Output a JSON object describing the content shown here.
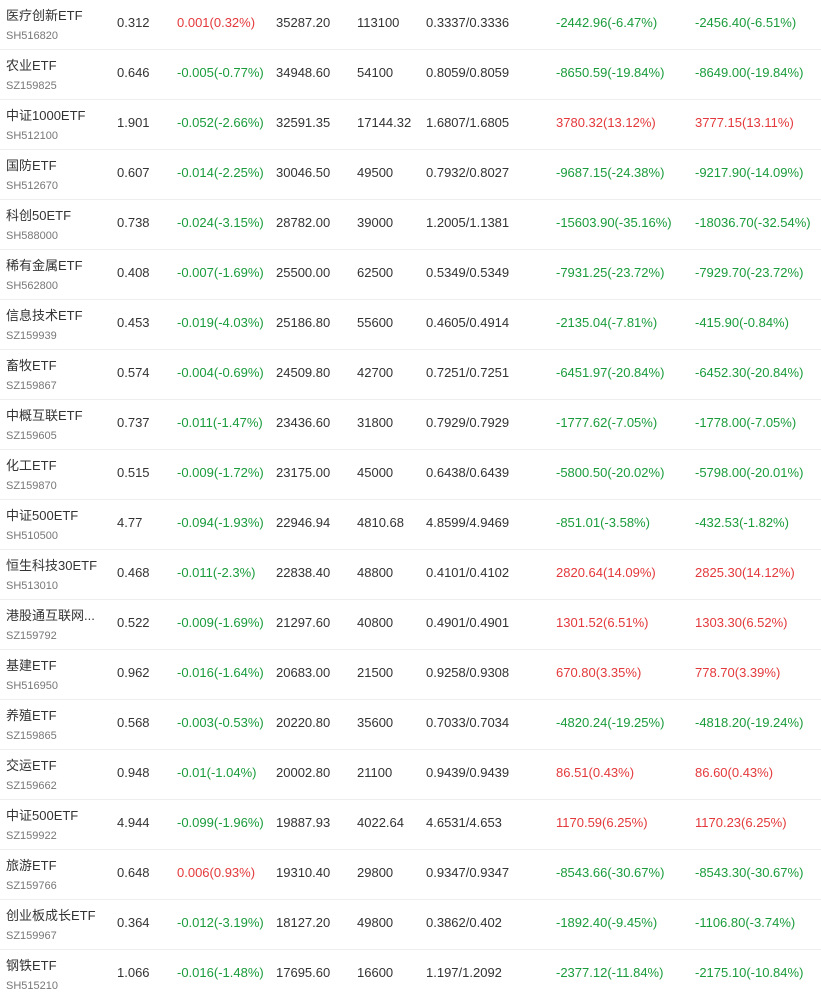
{
  "colors": {
    "up": "#e4393c",
    "down": "#1a9c3c",
    "text": "#333333",
    "subtext": "#777777",
    "divider": "#eeeeee"
  },
  "rows": [
    {
      "name": "医疗创新ETF",
      "code": "SH516820",
      "price": "0.312",
      "change": "0.001(0.32%)",
      "change_dir": "up",
      "amount": "35287.20",
      "share": "113100",
      "nav": "0.3337/0.3336",
      "pnl1": "-2442.96(-6.47%)",
      "pnl1_dir": "down",
      "pnl2": "-2456.40(-6.51%)",
      "pnl2_dir": "down"
    },
    {
      "name": "农业ETF",
      "code": "SZ159825",
      "price": "0.646",
      "change": "-0.005(-0.77%)",
      "change_dir": "down",
      "amount": "34948.60",
      "share": "54100",
      "nav": "0.8059/0.8059",
      "pnl1": "-8650.59(-19.84%)",
      "pnl1_dir": "down",
      "pnl2": "-8649.00(-19.84%)",
      "pnl2_dir": "down"
    },
    {
      "name": "中证1000ETF",
      "code": "SH512100",
      "price": "1.901",
      "change": "-0.052(-2.66%)",
      "change_dir": "down",
      "amount": "32591.35",
      "share": "17144.32",
      "nav": "1.6807/1.6805",
      "pnl1": "3780.32(13.12%)",
      "pnl1_dir": "up",
      "pnl2": "3777.15(13.11%)",
      "pnl2_dir": "up"
    },
    {
      "name": "国防ETF",
      "code": "SH512670",
      "price": "0.607",
      "change": "-0.014(-2.25%)",
      "change_dir": "down",
      "amount": "30046.50",
      "share": "49500",
      "nav": "0.7932/0.8027",
      "pnl1": "-9687.15(-24.38%)",
      "pnl1_dir": "down",
      "pnl2": "-9217.90(-14.09%)",
      "pnl2_dir": "down"
    },
    {
      "name": "科创50ETF",
      "code": "SH588000",
      "price": "0.738",
      "change": "-0.024(-3.15%)",
      "change_dir": "down",
      "amount": "28782.00",
      "share": "39000",
      "nav": "1.2005/1.1381",
      "pnl1": "-15603.90(-35.16%)",
      "pnl1_dir": "down",
      "pnl2": "-18036.70(-32.54%)",
      "pnl2_dir": "down"
    },
    {
      "name": "稀有金属ETF",
      "code": "SH562800",
      "price": "0.408",
      "change": "-0.007(-1.69%)",
      "change_dir": "down",
      "amount": "25500.00",
      "share": "62500",
      "nav": "0.5349/0.5349",
      "pnl1": "-7931.25(-23.72%)",
      "pnl1_dir": "down",
      "pnl2": "-7929.70(-23.72%)",
      "pnl2_dir": "down"
    },
    {
      "name": "信息技术ETF",
      "code": "SZ159939",
      "price": "0.453",
      "change": "-0.019(-4.03%)",
      "change_dir": "down",
      "amount": "25186.80",
      "share": "55600",
      "nav": "0.4605/0.4914",
      "pnl1": "-2135.04(-7.81%)",
      "pnl1_dir": "down",
      "pnl2": "-415.90(-0.84%)",
      "pnl2_dir": "down"
    },
    {
      "name": "畜牧ETF",
      "code": "SZ159867",
      "price": "0.574",
      "change": "-0.004(-0.69%)",
      "change_dir": "down",
      "amount": "24509.80",
      "share": "42700",
      "nav": "0.7251/0.7251",
      "pnl1": "-6451.97(-20.84%)",
      "pnl1_dir": "down",
      "pnl2": "-6452.30(-20.84%)",
      "pnl2_dir": "down"
    },
    {
      "name": "中概互联ETF",
      "code": "SZ159605",
      "price": "0.737",
      "change": "-0.011(-1.47%)",
      "change_dir": "down",
      "amount": "23436.60",
      "share": "31800",
      "nav": "0.7929/0.7929",
      "pnl1": "-1777.62(-7.05%)",
      "pnl1_dir": "down",
      "pnl2": "-1778.00(-7.05%)",
      "pnl2_dir": "down"
    },
    {
      "name": "化工ETF",
      "code": "SZ159870",
      "price": "0.515",
      "change": "-0.009(-1.72%)",
      "change_dir": "down",
      "amount": "23175.00",
      "share": "45000",
      "nav": "0.6438/0.6439",
      "pnl1": "-5800.50(-20.02%)",
      "pnl1_dir": "down",
      "pnl2": "-5798.00(-20.01%)",
      "pnl2_dir": "down"
    },
    {
      "name": "中证500ETF",
      "code": "SH510500",
      "price": "4.77",
      "change": "-0.094(-1.93%)",
      "change_dir": "down",
      "amount": "22946.94",
      "share": "4810.68",
      "nav": "4.8599/4.9469",
      "pnl1": "-851.01(-3.58%)",
      "pnl1_dir": "down",
      "pnl2": "-432.53(-1.82%)",
      "pnl2_dir": "down"
    },
    {
      "name": "恒生科技30ETF",
      "code": "SH513010",
      "price": "0.468",
      "change": "-0.011(-2.3%)",
      "change_dir": "down",
      "amount": "22838.40",
      "share": "48800",
      "nav": "0.4101/0.4102",
      "pnl1": "2820.64(14.09%)",
      "pnl1_dir": "up",
      "pnl2": "2825.30(14.12%)",
      "pnl2_dir": "up"
    },
    {
      "name": "港股通互联网...",
      "code": "SZ159792",
      "price": "0.522",
      "change": "-0.009(-1.69%)",
      "change_dir": "down",
      "amount": "21297.60",
      "share": "40800",
      "nav": "0.4901/0.4901",
      "pnl1": "1301.52(6.51%)",
      "pnl1_dir": "up",
      "pnl2": "1303.30(6.52%)",
      "pnl2_dir": "up"
    },
    {
      "name": "基建ETF",
      "code": "SH516950",
      "price": "0.962",
      "change": "-0.016(-1.64%)",
      "change_dir": "down",
      "amount": "20683.00",
      "share": "21500",
      "nav": "0.9258/0.9308",
      "pnl1": "670.80(3.35%)",
      "pnl1_dir": "up",
      "pnl2": "778.70(3.39%)",
      "pnl2_dir": "up"
    },
    {
      "name": "养殖ETF",
      "code": "SZ159865",
      "price": "0.568",
      "change": "-0.003(-0.53%)",
      "change_dir": "down",
      "amount": "20220.80",
      "share": "35600",
      "nav": "0.7033/0.7034",
      "pnl1": "-4820.24(-19.25%)",
      "pnl1_dir": "down",
      "pnl2": "-4818.20(-19.24%)",
      "pnl2_dir": "down"
    },
    {
      "name": "交运ETF",
      "code": "SZ159662",
      "price": "0.948",
      "change": "-0.01(-1.04%)",
      "change_dir": "down",
      "amount": "20002.80",
      "share": "21100",
      "nav": "0.9439/0.9439",
      "pnl1": "86.51(0.43%)",
      "pnl1_dir": "up",
      "pnl2": "86.60(0.43%)",
      "pnl2_dir": "up"
    },
    {
      "name": "中证500ETF",
      "code": "SZ159922",
      "price": "4.944",
      "change": "-0.099(-1.96%)",
      "change_dir": "down",
      "amount": "19887.93",
      "share": "4022.64",
      "nav": "4.6531/4.653",
      "pnl1": "1170.59(6.25%)",
      "pnl1_dir": "up",
      "pnl2": "1170.23(6.25%)",
      "pnl2_dir": "up"
    },
    {
      "name": "旅游ETF",
      "code": "SZ159766",
      "price": "0.648",
      "change": "0.006(0.93%)",
      "change_dir": "up",
      "amount": "19310.40",
      "share": "29800",
      "nav": "0.9347/0.9347",
      "pnl1": "-8543.66(-30.67%)",
      "pnl1_dir": "down",
      "pnl2": "-8543.30(-30.67%)",
      "pnl2_dir": "down"
    },
    {
      "name": "创业板成长ETF",
      "code": "SZ159967",
      "price": "0.364",
      "change": "-0.012(-3.19%)",
      "change_dir": "down",
      "amount": "18127.20",
      "share": "49800",
      "nav": "0.3862/0.402",
      "pnl1": "-1892.40(-9.45%)",
      "pnl1_dir": "down",
      "pnl2": "-1106.80(-3.74%)",
      "pnl2_dir": "down"
    },
    {
      "name": "钢铁ETF",
      "code": "SH515210",
      "price": "1.066",
      "change": "-0.016(-1.48%)",
      "change_dir": "down",
      "amount": "17695.60",
      "share": "16600",
      "nav": "1.197/1.2092",
      "pnl1": "-2377.12(-11.84%)",
      "pnl1_dir": "down",
      "pnl2": "-2175.10(-10.84%)",
      "pnl2_dir": "down"
    }
  ]
}
